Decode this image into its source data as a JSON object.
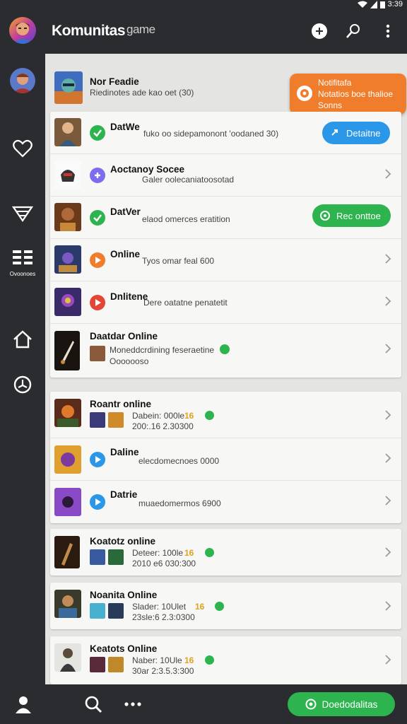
{
  "status_bar": {
    "time": "3:39",
    "icons": [
      "wifi-icon",
      "signal-icon",
      "battery-icon"
    ]
  },
  "header": {
    "title": "Komunitas",
    "title_suffix": "game",
    "actions": [
      "add-icon",
      "edit-icon",
      "more-vert-icon"
    ]
  },
  "sidebar": {
    "items": [
      "avatar",
      "heart-icon",
      "filter-icon",
      "menu-grid-icon",
      "home-icon",
      "history-icon"
    ],
    "menu_label": "Ovoonoes"
  },
  "featured": {
    "name": "Nor Feadie",
    "sub": "Riedinotes ade kao oet (30)"
  },
  "tooltip": {
    "line1": "Notifitafa",
    "line2": "Notatios boe thalioe",
    "line3": "Sonns"
  },
  "group1": [
    {
      "name": "DatWe",
      "sub": "fuko oo sidepamonont 'oodaned 30)",
      "status": "online",
      "action": {
        "label": "Detaitne",
        "color": "#2a97e8"
      }
    },
    {
      "name": "Aoctanoy Socee",
      "sub": "Galer oolecaniatoosotad",
      "status": "away"
    },
    {
      "name": "DatVer",
      "sub": "elaod omerces eratition",
      "status": "online",
      "action": {
        "label": "Rec onttoe",
        "color": "#2eb44e"
      }
    },
    {
      "name": "Online",
      "sub": "Tyos omar feal 600",
      "status": "busy"
    },
    {
      "name": "Dnlitene",
      "sub": "Dere oatatne penatetit",
      "status": "offline"
    },
    {
      "name": "Daatdar Online",
      "sub": "Moneddcrdining feseraetine",
      "sub2": "Ooooooso",
      "status": "online"
    }
  ],
  "group2": [
    {
      "name": "Roantr online",
      "sub": "Dabein: 000le",
      "sub2": "200:.16 2.30300",
      "status": "online"
    },
    {
      "name": "Daline",
      "sub": "elecdomecnoes 0000",
      "status": "idle"
    },
    {
      "name": "Datrie",
      "sub": "muaedomermos 6900",
      "status": "idle"
    }
  ],
  "group3": [
    {
      "name": "Koatotz online",
      "sub": "Deteer: 100le",
      "sub2": "2010 e6 030:300",
      "status": "online"
    },
    {
      "name": "Noanita Online",
      "sub": "Slader: 10Ulet",
      "sub2": "23sle:6 2.3:0300",
      "status": "online"
    },
    {
      "name": "Keatots Online",
      "sub": "Naber: 10Ule",
      "sub2": "30ar 2:3.5.3:300",
      "status": "online"
    }
  ],
  "badge_label": "16",
  "bottom_bar": {
    "cta_label": "Doedodalitas",
    "icons": [
      "profile-icon",
      "search-icon",
      "more-horiz-icon"
    ]
  },
  "colors": {
    "bg_dark": "#2b2c2f",
    "accent_orange": "#f07d2b",
    "accent_green": "#2eb44e",
    "accent_blue": "#2a97e8",
    "status_purple": "#7b6cf0",
    "status_orange": "#f07d2b",
    "status_red": "#e54535"
  }
}
